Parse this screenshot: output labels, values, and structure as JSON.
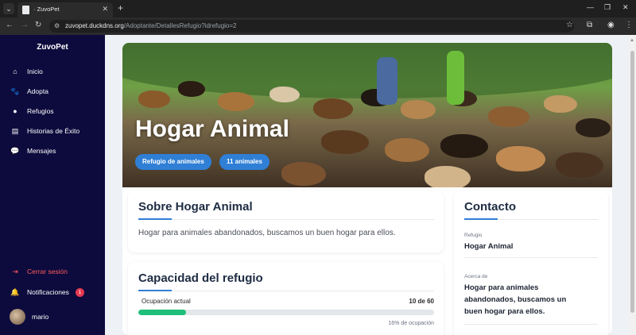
{
  "browser": {
    "tab_title": "· ZuvoPet",
    "url_host": "zuvopet.duckdns.org",
    "url_path": "/Adoptante/DetallesRefugio?idrefugio=2"
  },
  "sidebar": {
    "brand": "ZuvoPet",
    "items": [
      {
        "label": "Inicio",
        "icon": "home-icon"
      },
      {
        "label": "Adopta",
        "icon": "paw-icon"
      },
      {
        "label": "Refugios",
        "icon": "map-pin-icon"
      },
      {
        "label": "Historias de Éxito",
        "icon": "book-icon"
      },
      {
        "label": "Mensajes",
        "icon": "chat-icon"
      }
    ],
    "logout_label": "Cerrar sesión",
    "notifications_label": "Notificaciones",
    "notifications_count": "1",
    "user_name": "mario"
  },
  "hero": {
    "title": "Hogar Animal",
    "chip_type": "Refugio de animales",
    "chip_count": "11 animales"
  },
  "about": {
    "title": "Sobre Hogar Animal",
    "text": "Hogar para animales abandonados, buscamos un buen hogar para ellos."
  },
  "capacity": {
    "title": "Capacidad del refugio",
    "label": "Ocupación actual",
    "value": "10 de 60",
    "percent_text": "16% de ocupación",
    "fill_fraction": 0.16
  },
  "contact": {
    "title": "Contacto",
    "refugio_label": "Refugio",
    "refugio_value": "Hogar Animal",
    "about_label": "Acerca de",
    "about_value": "Hogar para animales abandonados, buscamos un buen hogar para ellos."
  },
  "colors": {
    "sidebar_bg": "#0d0a3d",
    "accent": "#2f7fd6",
    "progress": "#1fbf7a",
    "logout": "#ff5c5c"
  }
}
